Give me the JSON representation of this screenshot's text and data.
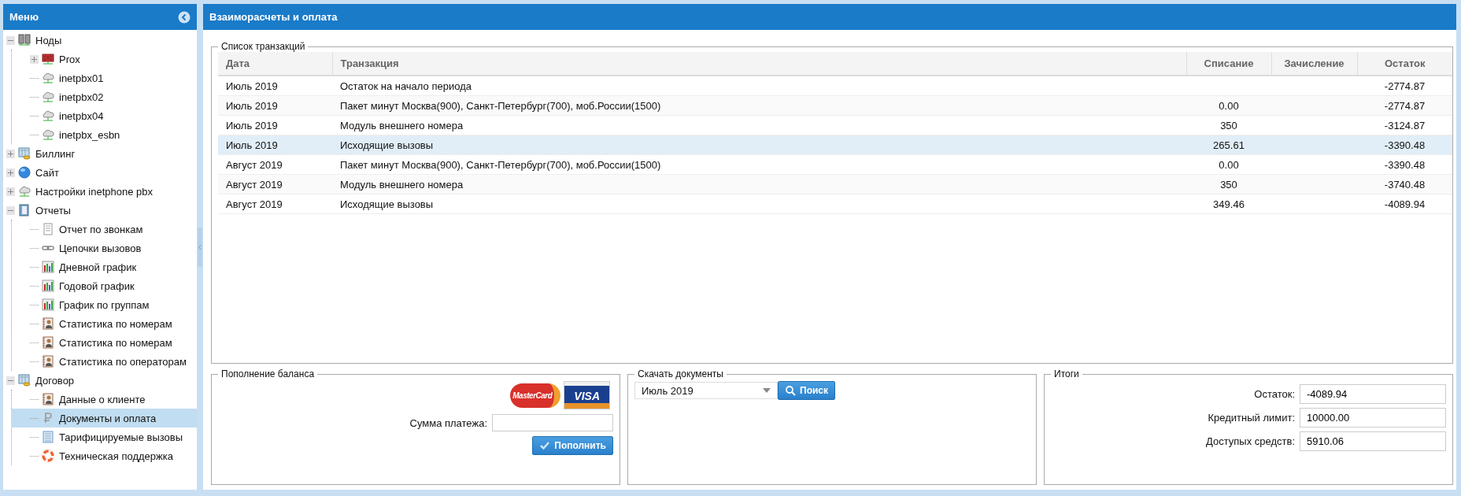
{
  "sidebar": {
    "title": "Меню",
    "tree": [
      {
        "label": "Ноды",
        "expanded": true,
        "selected": false,
        "children": [
          {
            "label": "Prox",
            "expanded": false,
            "selected": false
          },
          {
            "label": "inetpbx01",
            "selected": false
          },
          {
            "label": "inetpbx02",
            "selected": false
          },
          {
            "label": "inetpbx04",
            "selected": false
          },
          {
            "label": "inetpbx_esbn",
            "selected": false
          }
        ]
      },
      {
        "label": "Биллинг",
        "expanded": false,
        "selected": false
      },
      {
        "label": "Сайт",
        "expanded": false,
        "selected": false
      },
      {
        "label": "Настройки inetphone pbx",
        "expanded": false,
        "selected": false
      },
      {
        "label": "Отчеты",
        "expanded": true,
        "selected": false,
        "children": [
          {
            "label": "Отчет по звонкам",
            "selected": false
          },
          {
            "label": "Цепочки вызовов",
            "selected": false
          },
          {
            "label": "Дневной график",
            "selected": false
          },
          {
            "label": "Годовой график",
            "selected": false
          },
          {
            "label": "График по группам",
            "selected": false
          },
          {
            "label": "Статистика по номерам",
            "selected": false
          },
          {
            "label": "Статистика по номерам",
            "selected": false
          },
          {
            "label": "Статистика по операторам",
            "selected": false
          }
        ]
      },
      {
        "label": "Договор",
        "expanded": true,
        "selected": false,
        "children": [
          {
            "label": "Данные о клиенте",
            "selected": false
          },
          {
            "label": "Документы и оплата",
            "selected": true
          },
          {
            "label": "Тарифицируемые вызовы",
            "selected": false
          },
          {
            "label": "Техническая поддержка",
            "selected": false
          }
        ]
      }
    ]
  },
  "main": {
    "title": "Взаиморасчеты и оплата"
  },
  "transactions": {
    "title": "Список транзакций",
    "columns": [
      "Дата",
      "Транзакция",
      "Списание",
      "Зачисление",
      "Остаток"
    ],
    "rows": [
      {
        "cells": [
          "Июль 2019",
          "Остаток на начало периода",
          "",
          "",
          "-2774.87"
        ],
        "selected": false
      },
      {
        "cells": [
          "Июль 2019",
          "Пакет минут Москва(900), Санкт-Петербург(700), моб.России(1500)",
          "0.00",
          "",
          "-2774.87"
        ],
        "selected": false
      },
      {
        "cells": [
          "Июль 2019",
          "Модуль внешнего номера",
          "350",
          "",
          "-3124.87"
        ],
        "selected": false
      },
      {
        "cells": [
          "Июль 2019",
          "Исходящие вызовы",
          "265.61",
          "",
          "-3390.48"
        ],
        "selected": true
      },
      {
        "cells": [
          "Август 2019",
          "Пакет минут Москва(900), Санкт-Петербург(700), моб.России(1500)",
          "0.00",
          "",
          "-3390.48"
        ],
        "selected": false
      },
      {
        "cells": [
          "Август 2019",
          "Модуль внешнего номера",
          "350",
          "",
          "-3740.48"
        ],
        "selected": false
      },
      {
        "cells": [
          "Август 2019",
          "Исходящие вызовы",
          "349.46",
          "",
          "-4089.94"
        ],
        "selected": false
      }
    ]
  },
  "payment": {
    "title": "Пополнение баланса",
    "logos": [
      "MasterCard",
      "VISA"
    ],
    "amount_label": "Сумма платежа:",
    "button": "Пополнить"
  },
  "documents": {
    "title": "Скачать документы",
    "period": "Июль 2019",
    "button": "Поиск"
  },
  "totals": {
    "title": "Итоги",
    "fields": [
      {
        "label": "Остаток:",
        "value": "-4089.94"
      },
      {
        "label": "Кредитный лимит:",
        "value": "10000.00"
      },
      {
        "label": "Доступых средств:",
        "value": "5910.06"
      }
    ]
  }
}
